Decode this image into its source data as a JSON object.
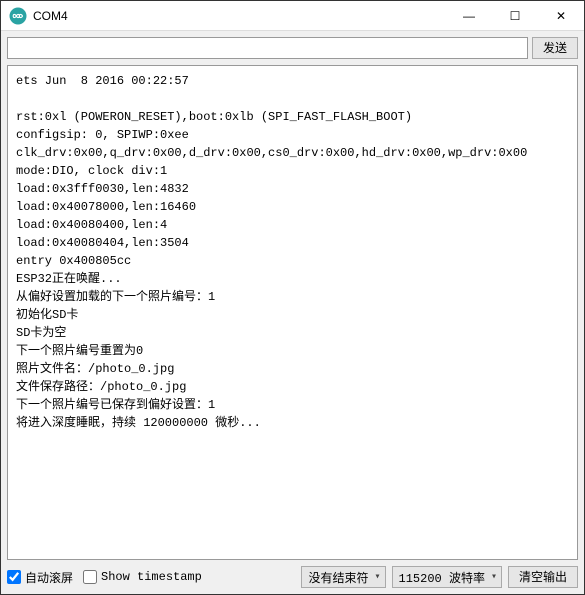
{
  "titlebar": {
    "title": "COM4",
    "icon_name": "arduino-infinity-icon",
    "minimize": "—",
    "maximize": "☐",
    "close": "✕"
  },
  "toolbar": {
    "input_value": "",
    "input_placeholder": "",
    "send_label": "发送"
  },
  "console_text": "ets Jun  8 2016 00:22:57\n\nrst:0xl (POWERON_RESET),boot:0xlb (SPI_FAST_FLASH_BOOT)\nconfigsip: 0, SPIWP:0xee\nclk_drv:0x00,q_drv:0x00,d_drv:0x00,cs0_drv:0x00,hd_drv:0x00,wp_drv:0x00\nmode:DIO, clock div:1\nload:0x3fff0030,len:4832\nload:0x40078000,len:16460\nload:0x40080400,len:4\nload:0x40080404,len:3504\nentry 0x400805cc\nESP32正在唤醒...\n从偏好设置加载的下一个照片编号：1\n初始化SD卡\nSD卡为空\n下一个照片编号重置为0\n照片文件名：/photo_0.jpg\n文件保存路径：/photo_0.jpg\n下一个照片编号已保存到偏好设置：1\n将进入深度睡眠，持续 120000000 微秒...",
  "statusbar": {
    "autoscroll_label": "自动滚屏",
    "autoscroll_checked": true,
    "show_timestamp_label": "Show timestamp",
    "show_timestamp_checked": false,
    "line_ending_selected": "没有结束符",
    "baud_selected": "115200 波特率",
    "clear_label": "清空输出"
  }
}
